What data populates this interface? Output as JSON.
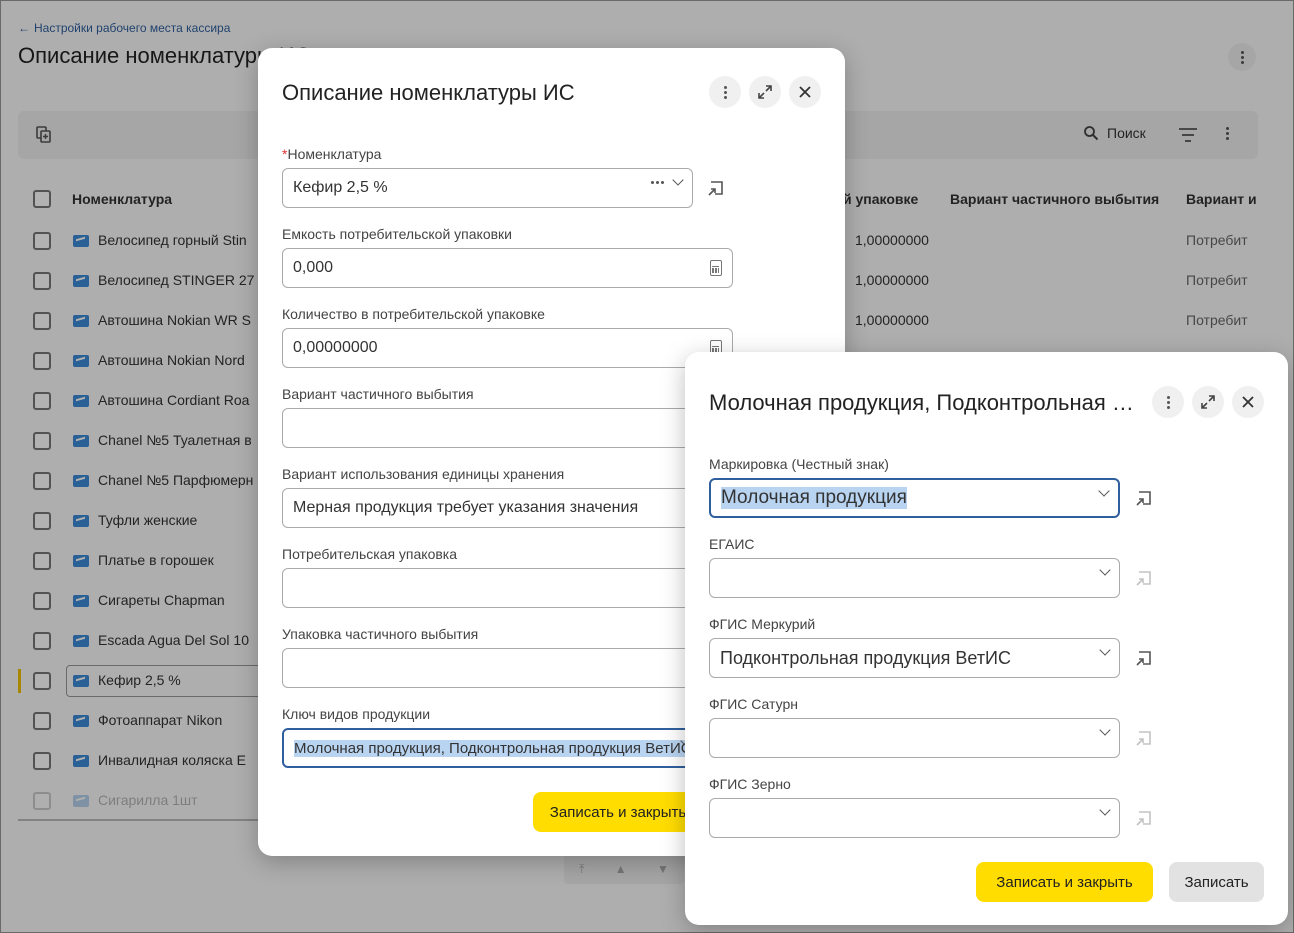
{
  "background": {
    "breadcrumb": "Настройки рабочего места кассира",
    "title": "Описание номенклатуры ИС",
    "toolbar": {
      "search_label": "Поиск"
    },
    "columns": [
      "Номенклатура",
      "й упаковке",
      "Вариант частичного выбытия",
      "Вариант и"
    ],
    "rows": [
      {
        "name": "Велосипед горный Stin",
        "qty": "1,00000000",
        "variant": "Потребит"
      },
      {
        "name": "Велосипед STINGER 27",
        "qty": "1,00000000",
        "variant": "Потребит"
      },
      {
        "name": "Автошина Nokian WR S",
        "qty": "1,00000000",
        "variant": "Потребит"
      },
      {
        "name": "Автошина Nokian Nord",
        "qty": "",
        "variant": ""
      },
      {
        "name": "Автошина Cordiant Roa",
        "qty": "",
        "variant": ""
      },
      {
        "name": "Chanel №5 Туалетная в",
        "qty": "",
        "variant": ""
      },
      {
        "name": "Chanel №5 Парфюмерн",
        "qty": "",
        "variant": ""
      },
      {
        "name": "Туфли женские",
        "qty": "",
        "variant": ""
      },
      {
        "name": "Платье в горошек",
        "qty": "",
        "variant": ""
      },
      {
        "name": "Сигареты Chapman",
        "qty": "",
        "variant": ""
      },
      {
        "name": "Escada Agua Del Sol 10",
        "qty": "",
        "variant": ""
      },
      {
        "name": "Кефир 2,5 %",
        "qty": "",
        "variant": ""
      },
      {
        "name": "Фотоаппарат Nikon",
        "qty": "",
        "variant": ""
      },
      {
        "name": "Инвалидная коляска E",
        "qty": "",
        "variant": ""
      },
      {
        "name": "Сигарилла 1шт",
        "qty": "",
        "variant": ""
      }
    ]
  },
  "dialog1": {
    "title": "Описание номенклатуры ИС",
    "fields": {
      "nomenclature": {
        "label": "Номенклатура",
        "required_mark": "*",
        "value": "Кефир 2,5 %"
      },
      "capacity": {
        "label": "Емкость потребительской упаковки",
        "value": "0,000"
      },
      "quantity": {
        "label": "Количество в потребительской упаковке",
        "value": "0,00000000"
      },
      "partial_variant": {
        "label": "Вариант частичного выбытия",
        "value": ""
      },
      "storage_variant": {
        "label": "Вариант использования единицы хранения",
        "value": "Мерная продукция требует указания значения"
      },
      "consumer_pack": {
        "label": "Потребительская упаковка",
        "value": ""
      },
      "partial_pack": {
        "label": "Упаковка частичного выбытия",
        "value": ""
      },
      "product_key": {
        "label": "Ключ видов продукции",
        "value": "Молочная продукция, Подконтрольная продукция ВетИС"
      }
    },
    "save_close": "Записать и закрыть"
  },
  "dialog2": {
    "title": "Молочная продукция, Подконтрольная продукция ВетИС",
    "fields": {
      "marking": {
        "label": "Маркировка (Честный знак)",
        "value": "Молочная продукция"
      },
      "egais": {
        "label": "ЕГАИС",
        "value": ""
      },
      "mercury": {
        "label": "ФГИС Меркурий",
        "value": "Подконтрольная продукция ВетИС"
      },
      "saturn": {
        "label": "ФГИС Сатурн",
        "value": ""
      },
      "zerno": {
        "label": "ФГИС Зерно",
        "value": ""
      }
    },
    "save_close": "Записать и закрыть",
    "save": "Записать"
  },
  "colors": {
    "accent": "#ffdd00",
    "link": "#2f5f9e",
    "focus": "#2f5f9e",
    "selection": "#b9d4f1",
    "required": "#dd3333"
  }
}
